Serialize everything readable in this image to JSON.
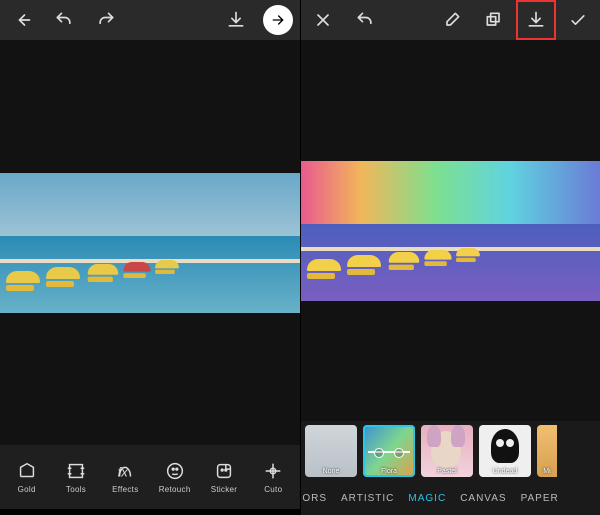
{
  "left": {
    "tools": [
      {
        "label": "Gold"
      },
      {
        "label": "Tools"
      },
      {
        "label": "Effects"
      },
      {
        "label": "Retouch"
      },
      {
        "label": "Sticker"
      },
      {
        "label": "Cuto"
      }
    ]
  },
  "right": {
    "effects": [
      {
        "label": "None"
      },
      {
        "label": "Flora",
        "selected": true
      },
      {
        "label": "Pastel"
      },
      {
        "label": "Undead"
      },
      {
        "label": "Mi"
      }
    ],
    "tabs": [
      {
        "label": "OLORS"
      },
      {
        "label": "ARTISTIC"
      },
      {
        "label": "MAGIC",
        "selected": true
      },
      {
        "label": "CANVAS"
      },
      {
        "label": "PAPER"
      }
    ]
  }
}
